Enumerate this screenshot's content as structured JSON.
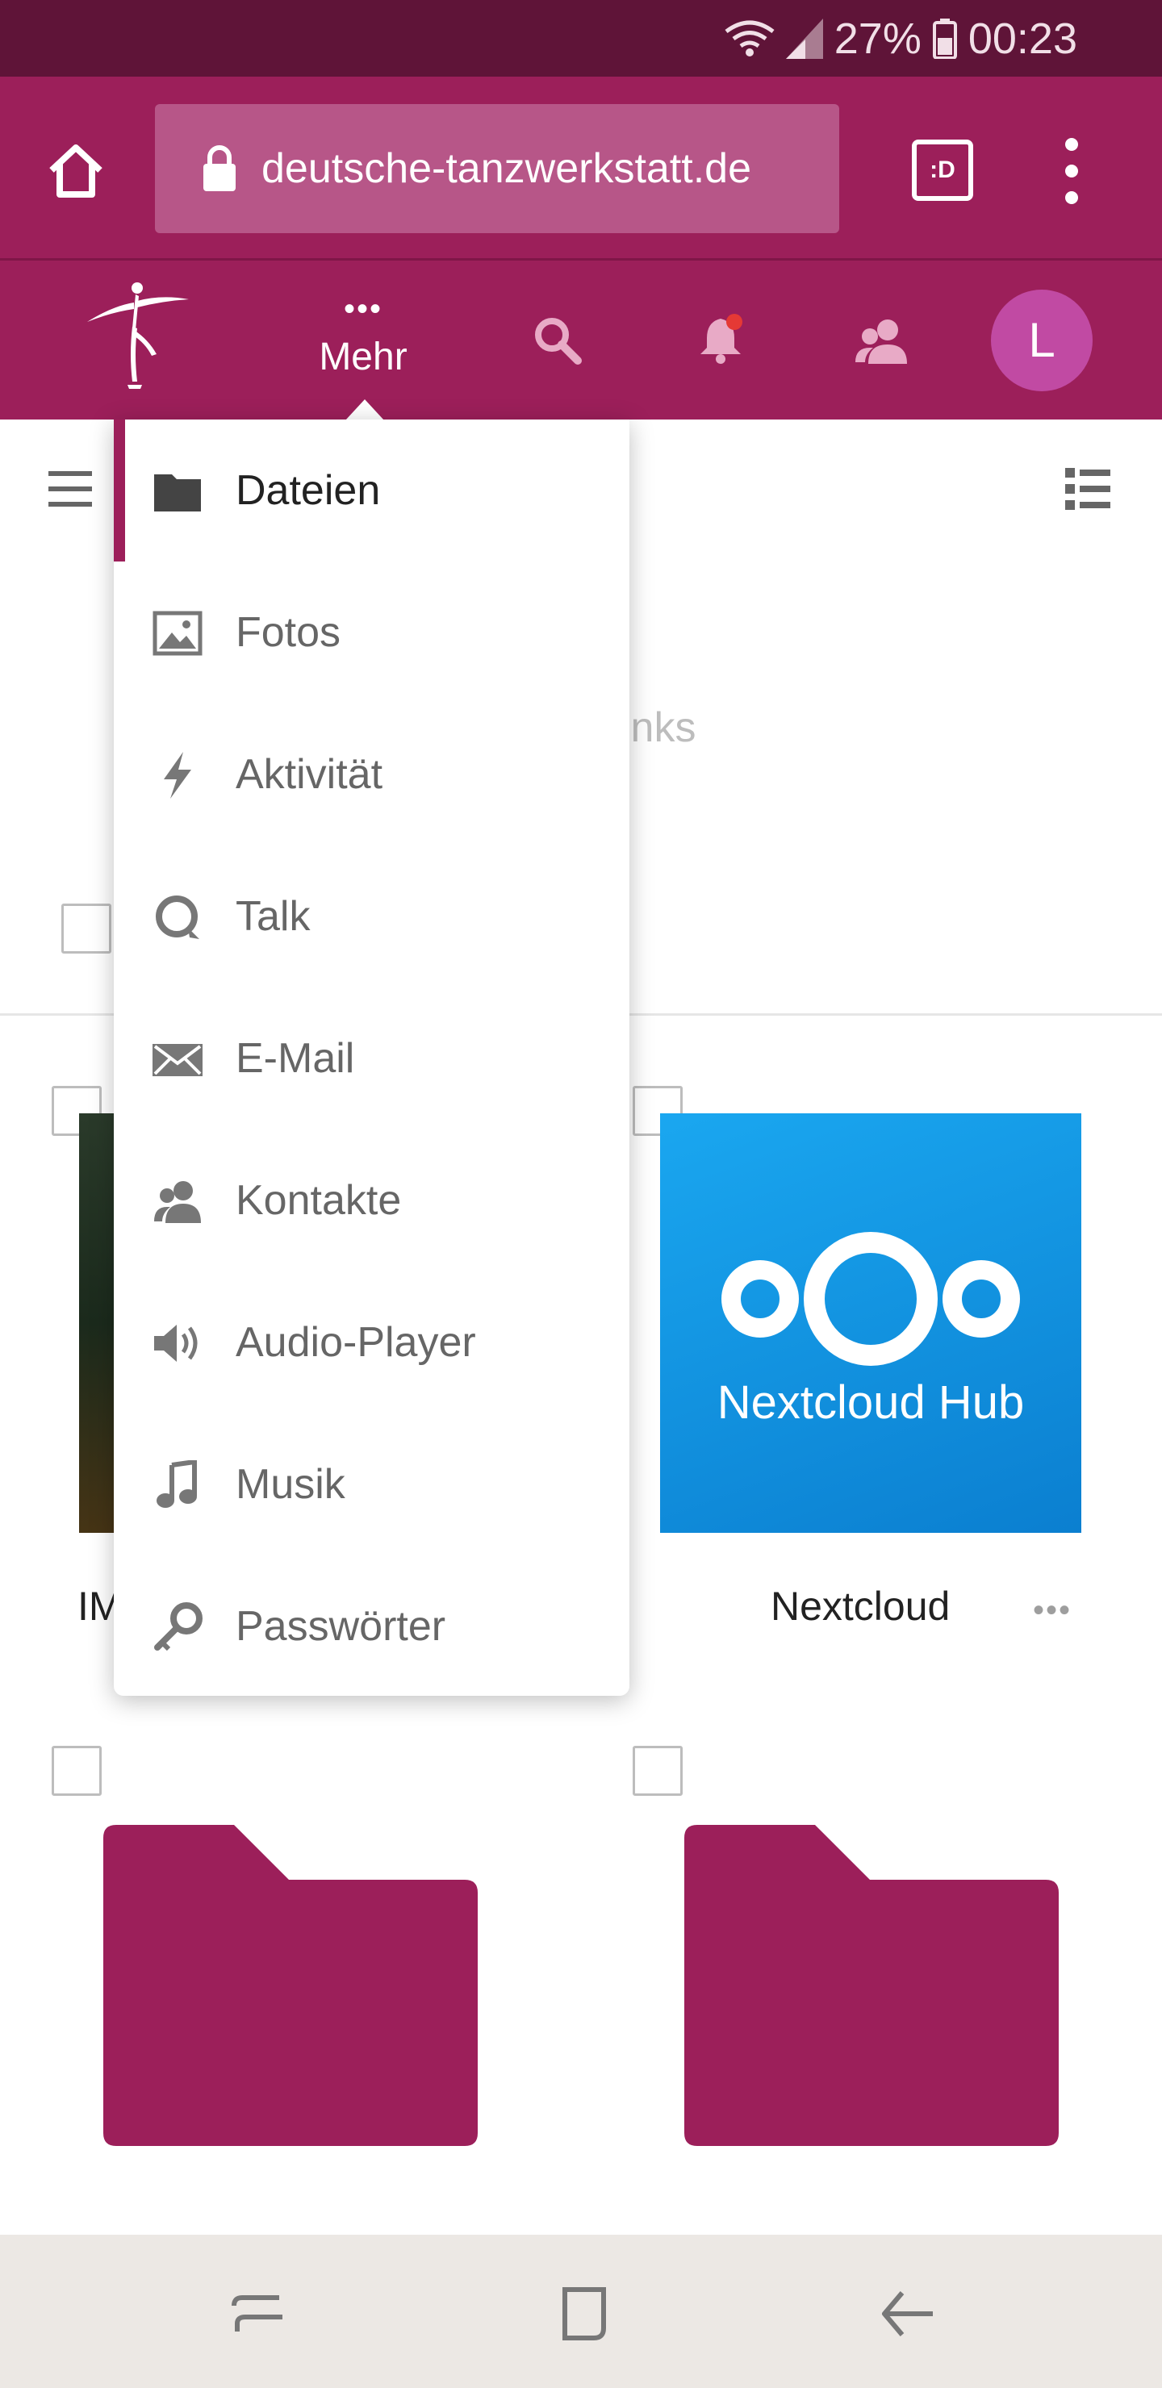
{
  "status_bar": {
    "battery": "27%",
    "time": "00:23",
    "icons": [
      "wifi-icon",
      "signal-icon",
      "battery-icon"
    ]
  },
  "browser": {
    "url": "deutsche-tanzwerkstatt.de",
    "tabs_label": ":D",
    "icons": [
      "home-icon",
      "lock-icon",
      "overflow-menu-icon"
    ]
  },
  "header": {
    "more_label": "Mehr",
    "more_dots": "•••",
    "avatar_letter": "L",
    "accent": "#9c1f5a",
    "icons": [
      "dancer-logo",
      "search-icon",
      "notifications-icon",
      "contacts-icon"
    ]
  },
  "menu": {
    "items": [
      {
        "label": "Dateien",
        "icon": "folder-icon",
        "active": true
      },
      {
        "label": "Fotos",
        "icon": "image-icon"
      },
      {
        "label": "Aktivität",
        "icon": "lightning-icon"
      },
      {
        "label": "Talk",
        "icon": "talk-icon"
      },
      {
        "label": "E-Mail",
        "icon": "mail-icon"
      },
      {
        "label": "Kontakte",
        "icon": "contacts-icon"
      },
      {
        "label": "Audio-Player",
        "icon": "speaker-icon"
      },
      {
        "label": "Musik",
        "icon": "music-icon"
      },
      {
        "label": "Passwörter",
        "icon": "key-icon"
      }
    ]
  },
  "files": {
    "background_text": "inks",
    "items": [
      {
        "name_partial": "IM",
        "thumbnail": "photo"
      },
      {
        "name": "Nextcloud",
        "more": "•••",
        "thumbnail_text": "Nextcloud Hub"
      },
      {
        "thumbnail": "folder"
      },
      {
        "thumbnail": "folder"
      }
    ]
  },
  "nav_bar": {
    "icons": [
      "recent-apps-icon",
      "home-button-icon",
      "back-icon"
    ]
  }
}
